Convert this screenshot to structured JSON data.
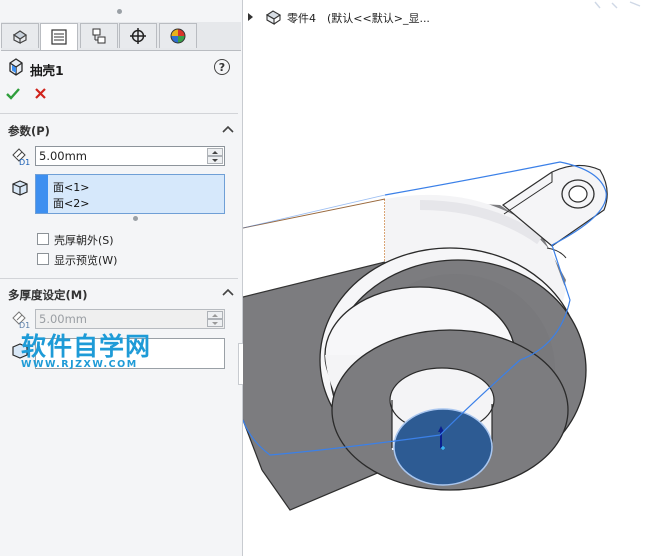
{
  "feature": {
    "title": "抽壳1",
    "help": "?"
  },
  "params": {
    "section_title": "参数(P)",
    "thickness": "5.00mm",
    "faces": [
      "面<1>",
      "面<2>"
    ],
    "shell_outward_label": "壳厚朝外(S)",
    "show_preview_label": "显示预览(W)"
  },
  "multi": {
    "section_title": "多厚度设定(M)",
    "thickness": "5.00mm"
  },
  "watermark": {
    "cn": "软件自学网",
    "url": "WWW.RJZXW.COM"
  },
  "tree": {
    "part_name": "零件4",
    "config": "(默认<<默认>_显..."
  },
  "colors": {
    "accent": "#3d8ff0",
    "face_highlight": "#2d5b93",
    "part_gray": "#7c7c7f"
  }
}
